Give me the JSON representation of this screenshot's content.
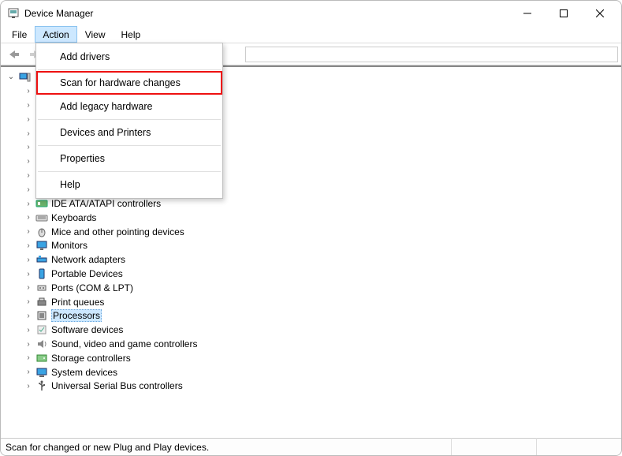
{
  "window": {
    "title": "Device Manager"
  },
  "menubar": [
    "File",
    "Action",
    "View",
    "Help"
  ],
  "active_menu_index": 1,
  "action_menu": {
    "items": [
      {
        "label": "Add drivers",
        "sep_after": true
      },
      {
        "label": "Scan for hardware changes",
        "highlighted": true
      },
      {
        "label": "Add legacy hardware",
        "sep_after": true
      },
      {
        "label": "Devices and Printers",
        "sep_after": true
      },
      {
        "label": "Properties",
        "sep_after": true
      },
      {
        "label": "Help"
      }
    ]
  },
  "tree": {
    "root_expanded": true,
    "root_label": "",
    "selected_label": "Processors",
    "categories": [
      {
        "label": "IDE ATA/ATAPI controllers",
        "icon": "ide"
      },
      {
        "label": "Keyboards",
        "icon": "keyboard"
      },
      {
        "label": "Mice and other pointing devices",
        "icon": "mouse"
      },
      {
        "label": "Monitors",
        "icon": "monitor"
      },
      {
        "label": "Network adapters",
        "icon": "network"
      },
      {
        "label": "Portable Devices",
        "icon": "portable"
      },
      {
        "label": "Ports (COM & LPT)",
        "icon": "port"
      },
      {
        "label": "Print queues",
        "icon": "printer"
      },
      {
        "label": "Processors",
        "icon": "cpu"
      },
      {
        "label": "Software devices",
        "icon": "software"
      },
      {
        "label": "Sound, video and game controllers",
        "icon": "sound"
      },
      {
        "label": "Storage controllers",
        "icon": "storage"
      },
      {
        "label": "System devices",
        "icon": "system"
      },
      {
        "label": "Universal Serial Bus controllers",
        "icon": "usb"
      }
    ],
    "obscured_count": 8
  },
  "statusbar": {
    "text": "Scan for changed or new Plug and Play devices."
  }
}
